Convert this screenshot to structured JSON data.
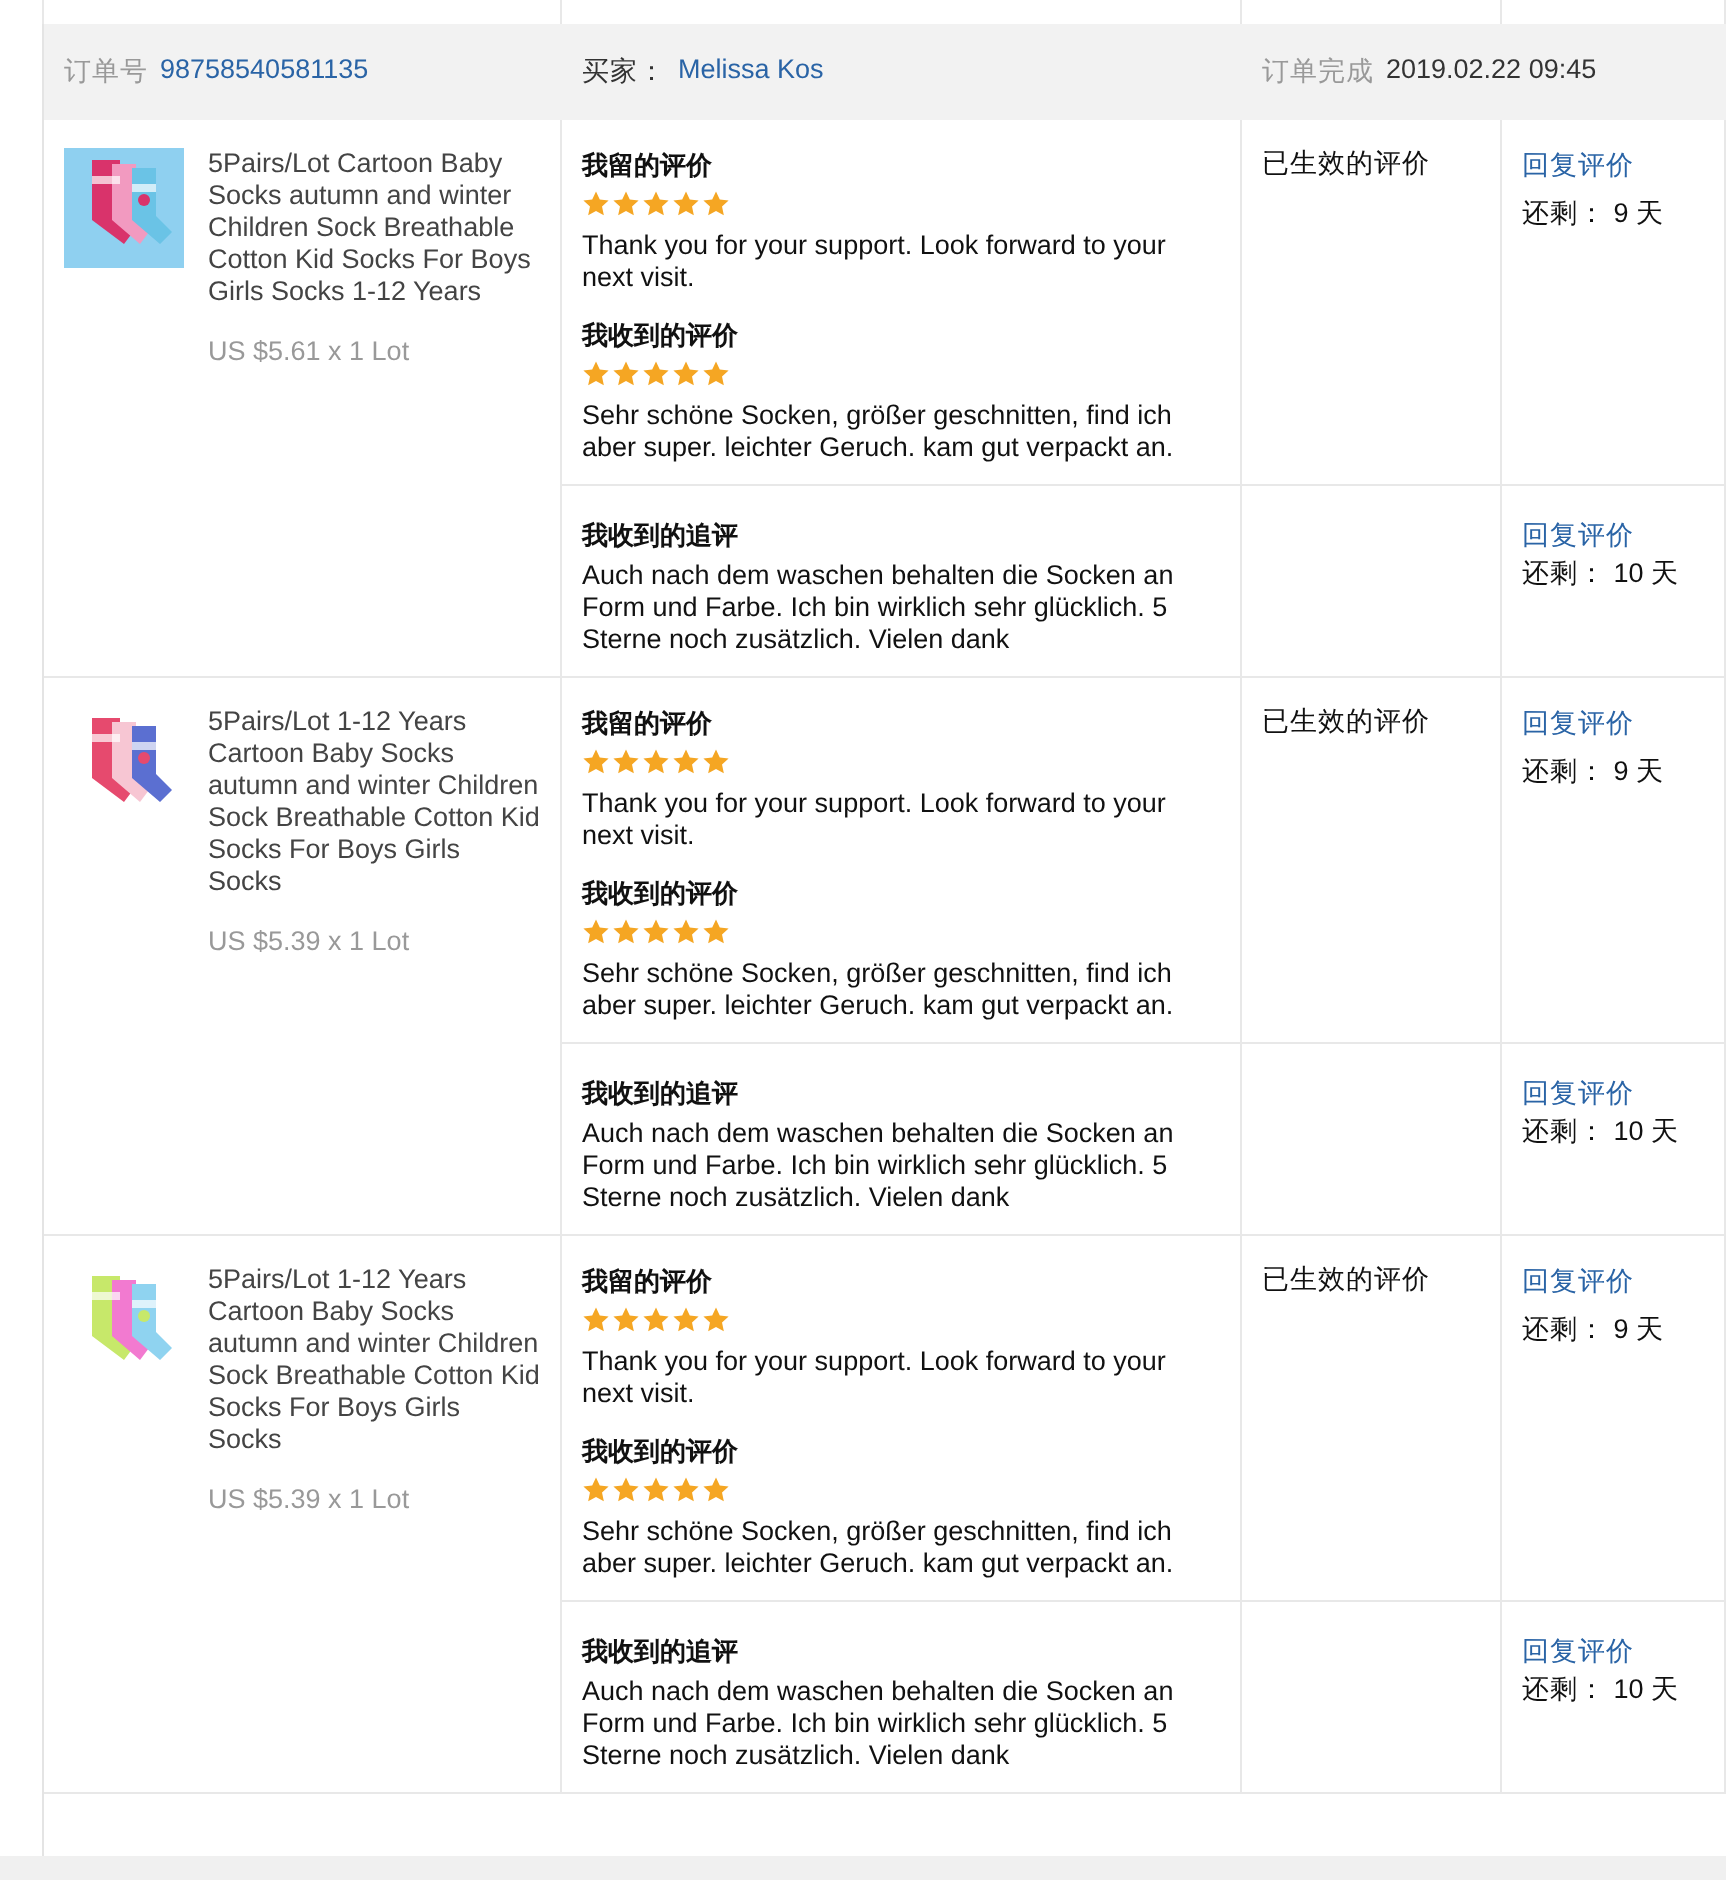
{
  "order": {
    "number_label": "订单号",
    "number": "98758540581135",
    "buyer_label": "买家：",
    "buyer": "Melissa Kos",
    "completed_label": "订单完成",
    "completed": "2019.02.22 09:45"
  },
  "items": [
    {
      "title": "5Pairs/Lot Cartoon Baby Socks autumn and winter Children Sock Breathable Cotton Kid Socks For Boys Girls Socks 1-12 Years",
      "price": "US $5.61 x 1 Lot",
      "given": {
        "heading": "我留的评价",
        "stars": 5,
        "text": "Thank you for your support. Look forward to your next visit."
      },
      "received": {
        "heading": "我收到的评价",
        "stars": 5,
        "text": "Sehr schöne Socken, größer geschnitten, find ich aber super. leichter Geruch. kam gut verpackt an."
      },
      "status": "已生效的评价",
      "reply": "回复评价",
      "remaining_label": "还剩：",
      "remaining": "9 天",
      "followup_heading": "我收到的追评",
      "followup_text": "Auch nach dem waschen behalten die Socken an Form und Farbe. Ich bin wirklich sehr glücklich. 5 Sterne noch zusätzlich. Vielen dank",
      "followup_reply": "回复评价",
      "followup_remaining_label": "还剩：",
      "followup_remaining": "10 天"
    },
    {
      "title": "5Pairs/Lot 1-12 Years Cartoon Baby Socks autumn and winter Children Sock Breathable Cotton Kid Socks For Boys Girls Socks",
      "price": "US $5.39 x 1 Lot",
      "given": {
        "heading": "我留的评价",
        "stars": 5,
        "text": "Thank you for your support. Look forward to your next visit."
      },
      "received": {
        "heading": "我收到的评价",
        "stars": 5,
        "text": "Sehr schöne Socken, größer geschnitten, find ich aber super. leichter Geruch. kam gut verpackt an."
      },
      "status": "已生效的评价",
      "reply": "回复评价",
      "remaining_label": "还剩：",
      "remaining": "9 天",
      "followup_heading": "我收到的追评",
      "followup_text": "Auch nach dem waschen behalten die Socken an Form und Farbe. Ich bin wirklich sehr glücklich. 5 Sterne noch zusätzlich. Vielen dank",
      "followup_reply": "回复评价",
      "followup_remaining_label": "还剩：",
      "followup_remaining": "10 天"
    },
    {
      "title": "5Pairs/Lot 1-12 Years Cartoon Baby Socks autumn and winter Children Sock Breathable Cotton Kid Socks For Boys Girls Socks",
      "price": "US $5.39 x 1 Lot",
      "given": {
        "heading": "我留的评价",
        "stars": 5,
        "text": "Thank you for your support. Look forward to your next visit."
      },
      "received": {
        "heading": "我收到的评价",
        "stars": 5,
        "text": "Sehr schöne Socken, größer geschnitten, find ich aber super. leichter Geruch. kam gut verpackt an."
      },
      "status": "已生效的评价",
      "reply": "回复评价",
      "remaining_label": "还剩：",
      "remaining": "9 天",
      "followup_heading": "我收到的追评",
      "followup_text": "Auch nach dem waschen behalten die Socken an Form und Farbe. Ich bin wirklich sehr glücklich. 5 Sterne noch zusätzlich. Vielen dank",
      "followup_reply": "回复评价",
      "followup_remaining_label": "还剩：",
      "followup_remaining": "10 天"
    }
  ]
}
